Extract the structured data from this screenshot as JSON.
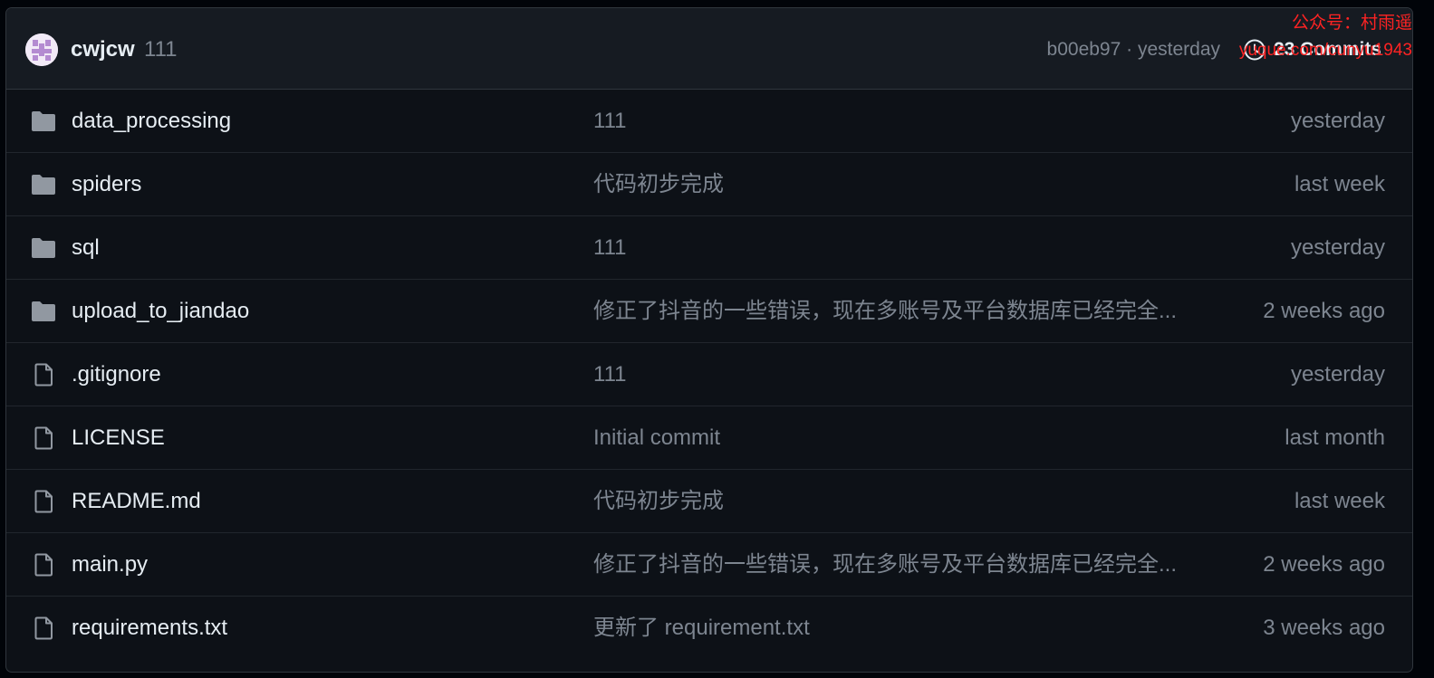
{
  "header": {
    "author": "cwjcw",
    "commit_message": "111",
    "commit_meta": "b00eb97 · yesterday",
    "commits_label": "23 Commits"
  },
  "watermark": {
    "line1": "公众号：村雨遥",
    "line2": "yuque.com/cunyu1943"
  },
  "files": [
    {
      "type": "folder",
      "name": "data_processing",
      "message": "111",
      "date": "yesterday"
    },
    {
      "type": "folder",
      "name": "spiders",
      "message": "代码初步完成",
      "date": "last week"
    },
    {
      "type": "folder",
      "name": "sql",
      "message": "111",
      "date": "yesterday"
    },
    {
      "type": "folder",
      "name": "upload_to_jiandao",
      "message": "修正了抖音的一些错误，现在多账号及平台数据库已经完全...",
      "date": "2 weeks ago"
    },
    {
      "type": "file",
      "name": ".gitignore",
      "message": "111",
      "date": "yesterday"
    },
    {
      "type": "file",
      "name": "LICENSE",
      "message": "Initial commit",
      "date": "last month"
    },
    {
      "type": "file",
      "name": "README.md",
      "message": "代码初步完成",
      "date": "last week"
    },
    {
      "type": "file",
      "name": "main.py",
      "message": "修正了抖音的一些错误，现在多账号及平台数据库已经完全...",
      "date": "2 weeks ago"
    },
    {
      "type": "file",
      "name": "requirements.txt",
      "message": "更新了 requirement.txt",
      "date": "3 weeks ago"
    }
  ],
  "colors": {
    "background": "#0d1117",
    "header_background": "#161b22",
    "primary_text": "#e6edf3",
    "muted_text": "#7d8590",
    "watermark": "#ff2323"
  }
}
